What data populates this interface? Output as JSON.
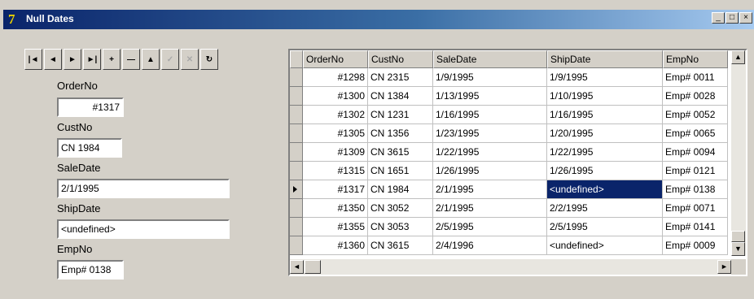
{
  "window": {
    "title": "Null Dates",
    "icon": "delphi-app-icon",
    "controls": [
      "_",
      "□",
      "×"
    ]
  },
  "navigator": {
    "buttons": [
      {
        "name": "first-record-button",
        "glyph": "|◄",
        "enabled": true
      },
      {
        "name": "prior-record-button",
        "glyph": "◄",
        "enabled": true
      },
      {
        "name": "next-record-button",
        "glyph": "►",
        "enabled": true
      },
      {
        "name": "last-record-button",
        "glyph": "►|",
        "enabled": true
      },
      {
        "name": "insert-record-button",
        "glyph": "+",
        "enabled": true
      },
      {
        "name": "delete-record-button",
        "glyph": "—",
        "enabled": true
      },
      {
        "name": "edit-record-button",
        "glyph": "▲",
        "enabled": true
      },
      {
        "name": "post-edit-button",
        "glyph": "✓",
        "enabled": false
      },
      {
        "name": "cancel-edit-button",
        "glyph": "✕",
        "enabled": false
      },
      {
        "name": "refresh-data-button",
        "glyph": "↻",
        "enabled": true
      }
    ]
  },
  "form": {
    "orderno_label": "OrderNo",
    "orderno_value": "#1317",
    "custno_label": "CustNo",
    "custno_value": "CN 1984",
    "saledate_label": "SaleDate",
    "saledate_value": "2/1/1995",
    "shipdate_label": "ShipDate",
    "shipdate_value": "<undefined>",
    "empno_label": "EmpNo",
    "empno_value": "Emp# 0138"
  },
  "grid": {
    "columns": [
      "OrderNo",
      "CustNo",
      "SaleDate",
      "ShipDate",
      "EmpNo"
    ],
    "rows": [
      [
        "#1298",
        "CN 2315",
        "1/9/1995",
        "1/9/1995",
        "Emp# 0011"
      ],
      [
        "#1300",
        "CN 1384",
        "1/13/1995",
        "1/10/1995",
        "Emp# 0028"
      ],
      [
        "#1302",
        "CN 1231",
        "1/16/1995",
        "1/16/1995",
        "Emp# 0052"
      ],
      [
        "#1305",
        "CN 1356",
        "1/23/1995",
        "1/20/1995",
        "Emp# 0065"
      ],
      [
        "#1309",
        "CN 3615",
        "1/22/1995",
        "1/22/1995",
        "Emp# 0094"
      ],
      [
        "#1315",
        "CN 1651",
        "1/26/1995",
        "1/26/1995",
        "Emp# 0121"
      ],
      [
        "#1317",
        "CN 1984",
        "2/1/1995",
        "<undefined>",
        "Emp# 0138"
      ],
      [
        "#1350",
        "CN 3052",
        "2/1/1995",
        "2/2/1995",
        "Emp# 0071"
      ],
      [
        "#1355",
        "CN 3053",
        "2/5/1995",
        "2/5/1995",
        "Emp# 0141"
      ],
      [
        "#1360",
        "CN 3615",
        "2/4/1996",
        "<undefined>",
        "Emp# 0009"
      ]
    ],
    "current_row": 6,
    "selected_column": 3
  }
}
